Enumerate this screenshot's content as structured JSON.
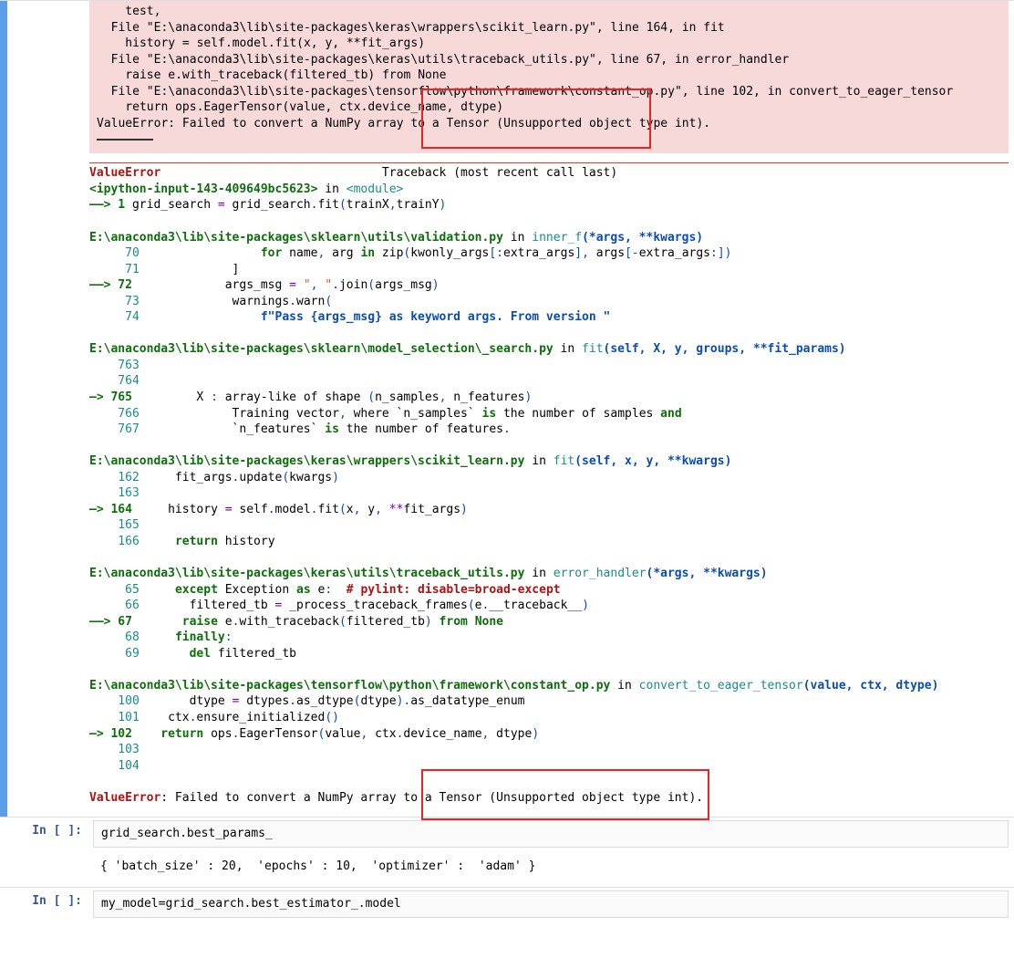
{
  "error_block": {
    "l1": "    test,",
    "l2": "  File \"E:\\anaconda3\\lib\\site-packages\\keras\\wrappers\\scikit_learn.py\", line 164, in fit",
    "l3": "    history = self.model.fit(x, y, **fit_args)",
    "l4": "  File \"E:\\anaconda3\\lib\\site-packages\\keras\\utils\\traceback_utils.py\", line 67, in error_handler",
    "l5": "    raise e.with_traceback(filtered_tb) from None",
    "l6": "  File \"E:\\anaconda3\\lib\\site-packages\\tensorflow\\python\\framework\\constant_op.py\", line 102, in convert_to_eager_tensor",
    "l7": "    return ops.EagerTensor(value, ctx.device_name, dtype)",
    "l8": "ValueError: Failed to convert a NumPy array to a Tensor (Unsupported object type int)."
  },
  "tb_header": {
    "err": "ValueError",
    "label": "Traceback (most recent call last)",
    "src_a": "<ipython-input-143-409649bc5623>",
    "src_b": " in ",
    "src_c": "<module>"
  },
  "frame0": {
    "arrow": "——> 1 ",
    "a": "grid_search ",
    "b": "=",
    "c": " grid_search",
    "d": ".",
    "e": "fit",
    "f": "(",
    "g": "trainX",
    "h": ",",
    "i": "trainY",
    "j": ")"
  },
  "frame1": {
    "path": "E:\\anaconda3\\lib\\site-packages\\sklearn\\utils\\validation.py",
    "in": " in ",
    "fn": "inner_f",
    "sig_a": "(*args, **kwargs)",
    "l70_no": "     70 ",
    "l70_a": "                ",
    "l70_for": "for",
    "l70_b": " name",
    "l70_c": ",",
    "l70_d": " arg ",
    "l70_in": "in",
    "l70_e": " zip",
    "l70_f": "(",
    "l70_g": "kwonly_args",
    "l70_h": "[:",
    "l70_i": "extra_args",
    "l70_j": "],",
    "l70_k": " args",
    "l70_l": "[-",
    "l70_m": "extra_args",
    "l70_n": ":])",
    "l71_no": "     71 ",
    "l71_a": "            ]",
    "l72_no": "——> 72 ",
    "l72_a": "            args_msg ",
    "l72_b": "=",
    "l72_c": " \"",
    "l72_d": ",",
    "l72_e": " \"",
    "l72_f": ".",
    "l72_g": "join",
    "l72_h": "(",
    "l72_i": "args_msg",
    "l72_j": ")",
    "l73_no": "     73 ",
    "l73_a": "            warnings",
    "l73_b": ".",
    "l73_c": "warn",
    "l73_d": "(",
    "l74_no": "     74 ",
    "l74_a": "                f\"Pass {args_msg} as keyword args. From version \""
  },
  "frame2": {
    "path": "E:\\anaconda3\\lib\\site-packages\\sklearn\\model_selection\\_search.py",
    "in": " in ",
    "fn": "fit",
    "sig": "(self, X, y, groups, **fit_params)",
    "l763_no": "    763 ",
    "l764_no": "    764 ",
    "l765_no": "—> 765 ",
    "l765_a": "        X ",
    "l765_b": ":",
    "l765_c": " array-like of shape ",
    "l765_d": "(",
    "l765_e": "n_samples",
    "l765_f": ",",
    "l765_g": " n_features",
    "l765_h": ")",
    "l766_no": "    766 ",
    "l766_a": "            Training vector",
    "l766_b": ",",
    "l766_c": " where `n_samples` ",
    "l766_is": "is",
    "l766_d": " the number of samples ",
    "l766_and": "and",
    "l767_no": "    767 ",
    "l767_a": "            `n_features` ",
    "l767_is": "is",
    "l767_b": " the number of features",
    "l767_c": "."
  },
  "frame3": {
    "path": "E:\\anaconda3\\lib\\site-packages\\keras\\wrappers\\scikit_learn.py",
    "in": " in ",
    "fn": "fit",
    "sig": "(self, x, y, **kwargs)",
    "l162_no": "    162 ",
    "l162_a": "    fit_args",
    "l162_b": ".",
    "l162_c": "update",
    "l162_d": "(",
    "l162_e": "kwargs",
    "l162_f": ")",
    "l163_no": "    163 ",
    "l164_no": "—> 164 ",
    "l164_a": "    history ",
    "l164_b": "=",
    "l164_c": " self",
    "l164_d": ".",
    "l164_e": "model",
    "l164_f": ".",
    "l164_g": "fit",
    "l164_h": "(",
    "l164_i": "x",
    "l164_j": ",",
    "l164_k": " y",
    "l164_l": ",",
    "l164_m": " **",
    "l164_n": "fit_args",
    "l164_o": ")",
    "l165_no": "    165 ",
    "l166_no": "    166 ",
    "l166_a": "    ",
    "l166_ret": "return",
    "l166_b": " history"
  },
  "frame4": {
    "path": "E:\\anaconda3\\lib\\site-packages\\keras\\utils\\traceback_utils.py",
    "in": " in ",
    "fn": "error_handler",
    "sig": "(*args, **kwargs)",
    "l65_no": "     65 ",
    "l65_a": "    ",
    "l65_except": "except",
    "l65_b": " Exception ",
    "l65_as": "as",
    "l65_c": " e",
    "l65_d": ":",
    "l65_e": "  # pylint: disable=broad-except",
    "l66_no": "     66 ",
    "l66_a": "      filtered_tb ",
    "l66_b": "=",
    "l66_c": " _process_traceback_frames",
    "l66_d": "(",
    "l66_e": "e",
    "l66_f": ".",
    "l66_g": "__traceback__",
    "l66_h": ")",
    "l67_no": "——> 67 ",
    "l67_a": "      ",
    "l67_raise": "raise",
    "l67_b": " e",
    "l67_c": ".",
    "l67_d": "with_traceback",
    "l67_e": "(",
    "l67_f": "filtered_tb",
    "l67_g": ")",
    "l67_h": " ",
    "l67_from": "from",
    "l67_i": " ",
    "l67_none": "None",
    "l68_no": "     68 ",
    "l68_a": "    ",
    "l68_fin": "finally",
    "l68_b": ":",
    "l69_no": "     69 ",
    "l69_a": "      ",
    "l69_del": "del",
    "l69_b": " filtered_tb"
  },
  "frame5": {
    "path": "E:\\anaconda3\\lib\\site-packages\\tensorflow\\python\\framework\\constant_op.py",
    "in": " in ",
    "fn": "convert_to_eager_tensor",
    "sig": "(value, ctx, dtype)",
    "l100_no": "    100 ",
    "l100_a": "      dtype ",
    "l100_b": "=",
    "l100_c": " dtypes",
    "l100_d": ".",
    "l100_e": "as_dtype",
    "l100_f": "(",
    "l100_g": "dtype",
    "l100_h": ").",
    "l100_i": "as_datatype_enum",
    "l101_no": "    101 ",
    "l101_a": "   ctx",
    "l101_b": ".",
    "l101_c": "ensure_initialized",
    "l101_d": "()",
    "l102_no": "—> 102 ",
    "l102_a": "   ",
    "l102_ret": "return",
    "l102_b": " ops",
    "l102_c": ".",
    "l102_d": "EagerTensor",
    "l102_e": "(",
    "l102_f": "value",
    "l102_g": ",",
    "l102_h": " ctx",
    "l102_i": ".",
    "l102_j": "device_name",
    "l102_k": ",",
    "l102_l": " dtype",
    "l102_m": ")",
    "l103_no": "    103 ",
    "l104_no": "    104 "
  },
  "final_err": {
    "name": "ValueError",
    "msg": ": Failed to convert a NumPy array to a Tensor (Unsupported object type int)."
  },
  "cell2": {
    "prompt": "In  [  ]:",
    "code": "grid_search.best_params_",
    "output": "{ 'batch_size' : 20,  'epochs' : 10,  'optimizer' :  'adam' }"
  },
  "cell3": {
    "prompt": "In  [  ]:",
    "code": "my_model=grid_search.best_estimator_.model"
  }
}
